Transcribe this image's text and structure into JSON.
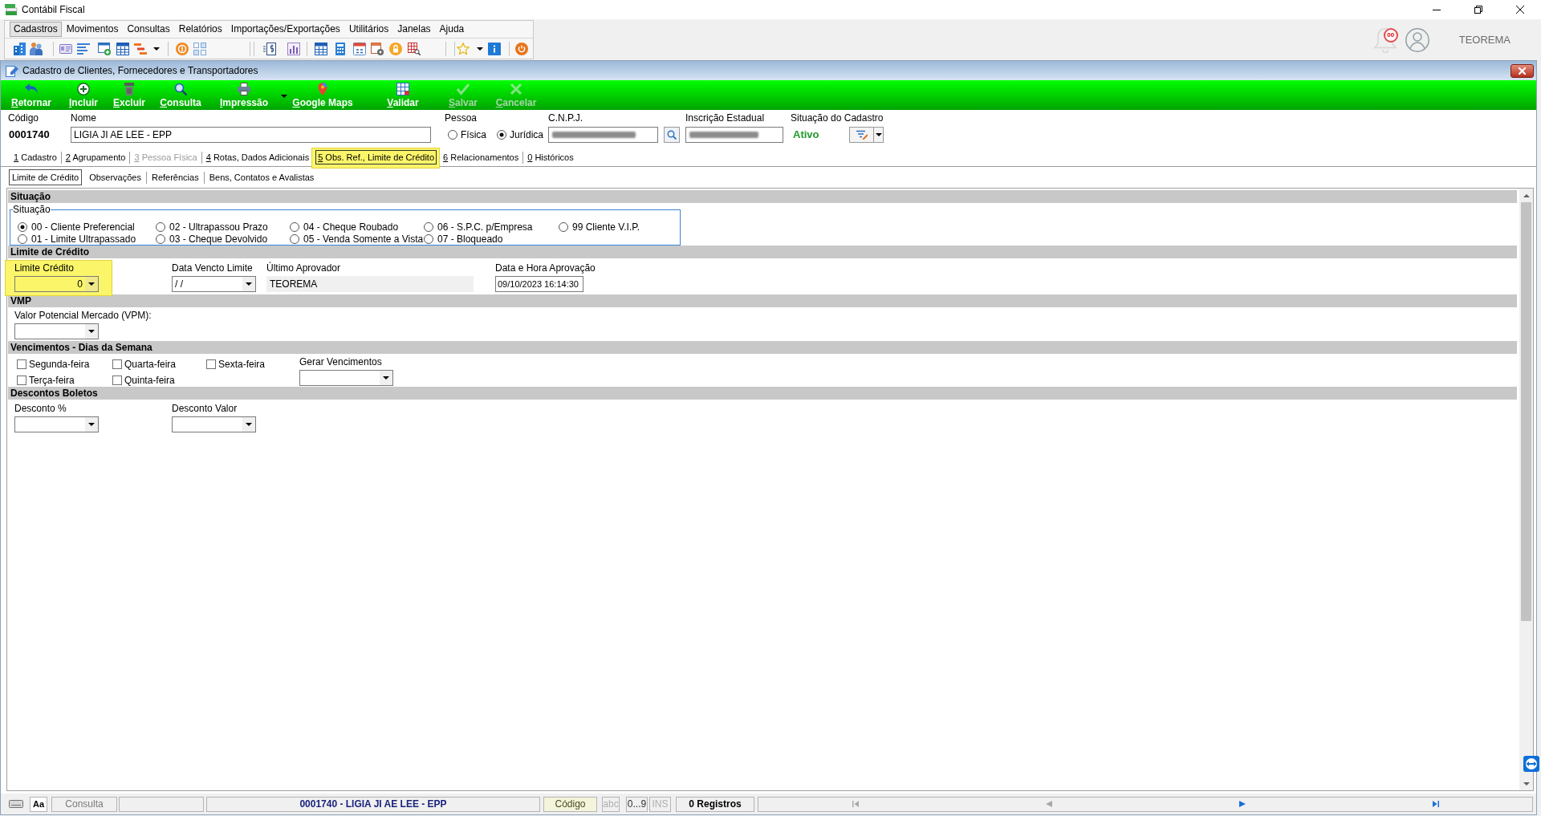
{
  "app": {
    "title": "Contábil Fiscal"
  },
  "menu": [
    {
      "label": "Cadastros",
      "selected": true
    },
    {
      "label": "Movimentos",
      "selected": false
    },
    {
      "label": "Consultas",
      "selected": false
    },
    {
      "label": "Relatórios",
      "selected": false
    },
    {
      "label": "Importações/Exportações",
      "selected": false
    },
    {
      "label": "Utilitários",
      "selected": false
    },
    {
      "label": "Janelas",
      "selected": false
    },
    {
      "label": "Ajuda",
      "selected": false
    }
  ],
  "user_area": {
    "notification_count": "00",
    "user_name": "TEOREMA"
  },
  "form_window": {
    "title": "Cadastro de Clientes, Fornecedores e Transportadores"
  },
  "actions": [
    {
      "label": "Retornar",
      "disabled": false,
      "dropdown": false
    },
    {
      "label": "Incluir",
      "disabled": false,
      "dropdown": false
    },
    {
      "label": "Excluir",
      "disabled": false,
      "dropdown": false
    },
    {
      "label": "Consulta",
      "disabled": false,
      "dropdown": false
    },
    {
      "label": "Impressão",
      "disabled": false,
      "dropdown": true
    },
    {
      "label": "Google Maps",
      "disabled": false,
      "dropdown": false
    },
    {
      "label": "Validar",
      "disabled": false,
      "dropdown": false
    },
    {
      "label": "Salvar",
      "disabled": true,
      "dropdown": false
    },
    {
      "label": "Cancelar",
      "disabled": true,
      "dropdown": false
    }
  ],
  "header": {
    "codigo": {
      "label": "Código",
      "value": "0001740"
    },
    "nome": {
      "label": "Nome",
      "value": "LIGIA JI AE LEE - EPP"
    },
    "pessoa": {
      "label": "Pessoa",
      "options": [
        {
          "label": "Física",
          "selected": false
        },
        {
          "label": "Jurídica",
          "selected": true
        }
      ]
    },
    "cnpj": {
      "label": "C.N.P.J."
    },
    "inscricao_estadual": {
      "label": "Inscrição Estadual"
    },
    "situacao_cadastro": {
      "label": "Situação do Cadastro",
      "value": "Ativo"
    }
  },
  "tabs": [
    {
      "label": "1 Cadastro",
      "selected": false,
      "disabled": false,
      "highlighted": false
    },
    {
      "label": "2 Agrupamento",
      "selected": false,
      "disabled": false,
      "highlighted": false
    },
    {
      "label": "3 Pessoa Física",
      "selected": false,
      "disabled": true,
      "highlighted": false
    },
    {
      "label": "4 Rotas, Dados Adicionais",
      "selected": false,
      "disabled": false,
      "highlighted": false
    },
    {
      "label": "5 Obs. Ref., Limite de Crédito",
      "selected": true,
      "disabled": false,
      "highlighted": true
    },
    {
      "label": "6 Relacionamentos",
      "selected": false,
      "disabled": false,
      "highlighted": false
    },
    {
      "label": "0 Históricos",
      "selected": false,
      "disabled": false,
      "highlighted": false
    }
  ],
  "subtabs": [
    {
      "label": "Limite de Crédito",
      "selected": true
    },
    {
      "label": "Observações",
      "selected": false
    },
    {
      "label": "Referências",
      "selected": false
    },
    {
      "label": "Bens, Contatos e Avalistas",
      "selected": false
    }
  ],
  "sections": [
    {
      "title": "Situação",
      "kind": "radio_group",
      "group_label": "Situação",
      "options": [
        {
          "label": "00 - Cliente Preferencial",
          "selected": true
        },
        {
          "label": "01 - Limite Ultrapassado",
          "selected": false
        },
        {
          "label": "02 - Ultrapassou Prazo",
          "selected": false
        },
        {
          "label": "03 - Cheque Devolvido",
          "selected": false
        },
        {
          "label": "04 - Cheque Roubado",
          "selected": false
        },
        {
          "label": "05 - Venda Somente a Vista",
          "selected": false
        },
        {
          "label": "06 - S.P.C. p/Empresa",
          "selected": false
        },
        {
          "label": "07 - Bloqueado",
          "selected": false
        },
        {
          "label": "99 Cliente V.I.P.",
          "selected": false
        }
      ]
    },
    {
      "title": "Limite de Crédito",
      "kind": "fields",
      "fields": [
        {
          "label": "Limite Crédito",
          "kind": "numeric",
          "value": "0",
          "highlighted": true
        },
        {
          "label": "Data Vencto Limite",
          "kind": "date",
          "value": "/ /",
          "highlighted": false
        },
        {
          "label": "Último Aprovador",
          "kind": "readonly",
          "value": "TEOREMA",
          "highlighted": false
        },
        {
          "label": "Data e Hora Aprovação",
          "kind": "text",
          "value": "09/10/2023 16:14:30",
          "highlighted": false
        }
      ]
    },
    {
      "title": "VMP",
      "kind": "fields",
      "fields": [
        {
          "label": "Valor Potencial Mercado (VPM):",
          "kind": "dropdown",
          "highlighted": false
        }
      ]
    },
    {
      "title": "Vencimentos - Dias da Semana",
      "kind": "checkboxes",
      "checkboxes": [
        {
          "label": "Segunda-feira",
          "checked": false
        },
        {
          "label": "Terça-feira",
          "checked": false
        },
        {
          "label": "Quarta-feira",
          "checked": false
        },
        {
          "label": "Quinta-feira",
          "checked": false
        },
        {
          "label": "Sexta-feira",
          "checked": false
        }
      ],
      "fields": [
        {
          "label": "Gerar Vencimentos",
          "kind": "dropdown",
          "highlighted": false
        }
      ]
    },
    {
      "title": "Descontos Boletos",
      "kind": "fields",
      "fields": [
        {
          "label": "Desconto %",
          "kind": "dropdown",
          "highlighted": false
        },
        {
          "label": "Desconto Valor",
          "kind": "dropdown",
          "highlighted": false
        }
      ]
    }
  ],
  "status_bar": {
    "font_button": "Aa",
    "mode": "Consulta",
    "record": "0001740 - LIGIA JI AE LEE - EPP",
    "sort_field": "Código",
    "indicators": [
      {
        "label": "abc",
        "on": false
      },
      {
        "label": "0...9",
        "on": true
      },
      {
        "label": "INS",
        "on": false
      }
    ],
    "record_count": "0 Registros",
    "navigation": [
      {
        "kind": "first",
        "disabled": true
      },
      {
        "kind": "previous",
        "disabled": true
      },
      {
        "kind": "next",
        "disabled": false
      },
      {
        "kind": "last",
        "disabled": false
      }
    ]
  }
}
